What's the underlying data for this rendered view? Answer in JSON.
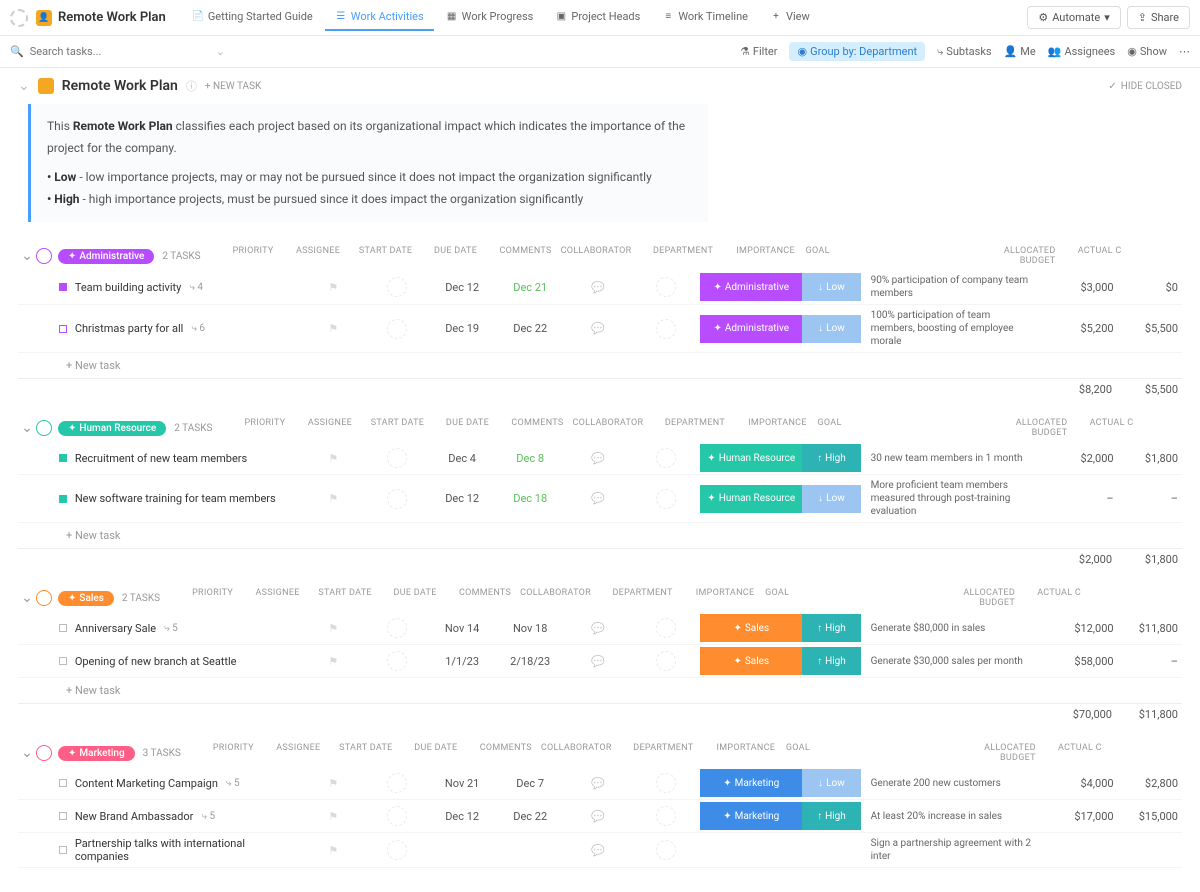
{
  "header": {
    "title": "Remote Work Plan",
    "tabs": [
      {
        "label": "Getting Started Guide"
      },
      {
        "label": "Work Activities",
        "active": true
      },
      {
        "label": "Work Progress"
      },
      {
        "label": "Project Heads"
      },
      {
        "label": "Work Timeline"
      },
      {
        "label": "View",
        "plus": true
      }
    ],
    "automate": "Automate",
    "share": "Share"
  },
  "toolbar": {
    "search_ph": "Search tasks...",
    "filter": "Filter",
    "groupby": "Group by: Department",
    "subtasks": "Subtasks",
    "me": "Me",
    "assignees": "Assignees",
    "show": "Show"
  },
  "page": {
    "title": "Remote Work Plan",
    "newtask": "+ NEW TASK",
    "hide_closed": "HIDE CLOSED"
  },
  "desc": {
    "line1a": "This ",
    "line1b": "Remote Work Plan",
    "line1c": " classifies each project based on its organizational impact which indicates the importance of the project for the company.",
    "low_lbl": "• Low",
    "low_txt": " - low importance projects, may or may not be pursued since it does not impact the organization significantly",
    "high_lbl": "• High",
    "high_txt": " - high importance projects, must be pursued since it does impact the organization significantly"
  },
  "cols": {
    "priority": "PRIORITY",
    "assignee": "ASSIGNEE",
    "start": "START DATE",
    "due": "DUE DATE",
    "comments": "COMMENTS",
    "collab": "COLLABORATOR",
    "dept": "DEPARTMENT",
    "imp": "IMPORTANCE",
    "goal": "GOAL",
    "budget": "ALLOCATED BUDGET",
    "actual": "ACTUAL C"
  },
  "labels": {
    "new_task": "+ New task",
    "low": "Low",
    "high": "High"
  },
  "groups": [
    {
      "key": "admin",
      "name": "Administrative",
      "count": "2 TASKS",
      "tasks": [
        {
          "name": "Team building activity",
          "sub": "4",
          "sd": "Dec 12",
          "dd": "Dec 21",
          "ddc": "green",
          "dept": "Administrative",
          "imp": "Low",
          "goal": "90% participation of company team members",
          "budget": "$3,000",
          "actual": "$0",
          "sqout": false
        },
        {
          "name": "Christmas party for all",
          "sub": "6",
          "sd": "Dec 19",
          "dd": "Dec 22",
          "ddc": "",
          "dept": "Administrative",
          "imp": "Low",
          "goal": "100% participation of team members, boosting of employee morale",
          "budget": "$5,200",
          "actual": "$5,500",
          "sqout": true
        }
      ],
      "tot_budget": "$8,200",
      "tot_actual": "$5,500"
    },
    {
      "key": "hr",
      "name": "Human Resource",
      "count": "2 TASKS",
      "tasks": [
        {
          "name": "Recruitment of new team members",
          "sub": "",
          "sd": "Dec 4",
          "dd": "Dec 8",
          "ddc": "green",
          "dept": "Human Resource",
          "imp": "High",
          "goal": "30 new team members in 1 month",
          "budget": "$2,000",
          "actual": "$1,800",
          "sqout": false
        },
        {
          "name": "New software training for team members",
          "sub": "",
          "sd": "Dec 12",
          "dd": "Dec 18",
          "ddc": "green",
          "dept": "Human Resource",
          "imp": "Low",
          "goal": "More proficient team members measured through post-training evaluation",
          "budget": "–",
          "actual": "–",
          "sqout": false
        }
      ],
      "tot_budget": "$2,000",
      "tot_actual": "$1,800"
    },
    {
      "key": "sales",
      "name": "Sales",
      "count": "2 TASKS",
      "tasks": [
        {
          "name": "Anniversary Sale",
          "sub": "5",
          "sd": "Nov 14",
          "dd": "Nov 18",
          "ddc": "",
          "dept": "Sales",
          "imp": "High",
          "goal": "Generate $80,000 in sales",
          "budget": "$12,000",
          "actual": "$11,800",
          "sqout": true
        },
        {
          "name": "Opening of new branch at Seattle",
          "sub": "",
          "sd": "1/1/23",
          "dd": "2/18/23",
          "ddc": "",
          "dept": "Sales",
          "imp": "High",
          "goal": "Generate $30,000 sales per month",
          "budget": "$58,000",
          "actual": "–",
          "sqout": true
        }
      ],
      "tot_budget": "$70,000",
      "tot_actual": "$11,800"
    },
    {
      "key": "mkt",
      "name": "Marketing",
      "count": "3 TASKS",
      "tasks": [
        {
          "name": "Content Marketing Campaign",
          "sub": "5",
          "sd": "Nov 21",
          "dd": "Dec 7",
          "ddc": "",
          "dept": "Marketing",
          "imp": "Low",
          "goal": "Generate 200 new customers",
          "budget": "$4,000",
          "actual": "$2,800",
          "sqout": true
        },
        {
          "name": "New Brand Ambassador",
          "sub": "5",
          "sd": "Dec 12",
          "dd": "Dec 22",
          "ddc": "",
          "dept": "Marketing",
          "imp": "High",
          "goal": "At least 20% increase in sales",
          "budget": "$17,000",
          "actual": "$15,000",
          "sqout": true
        },
        {
          "name": "Partnership talks with international companies",
          "sub": "",
          "sd": "",
          "dd": "",
          "ddc": "",
          "dept": "",
          "imp": "",
          "goal": "Sign a partnership agreement with 2 inter",
          "budget": "",
          "actual": "",
          "sqout": true
        }
      ],
      "tot_budget": "",
      "tot_actual": ""
    }
  ]
}
